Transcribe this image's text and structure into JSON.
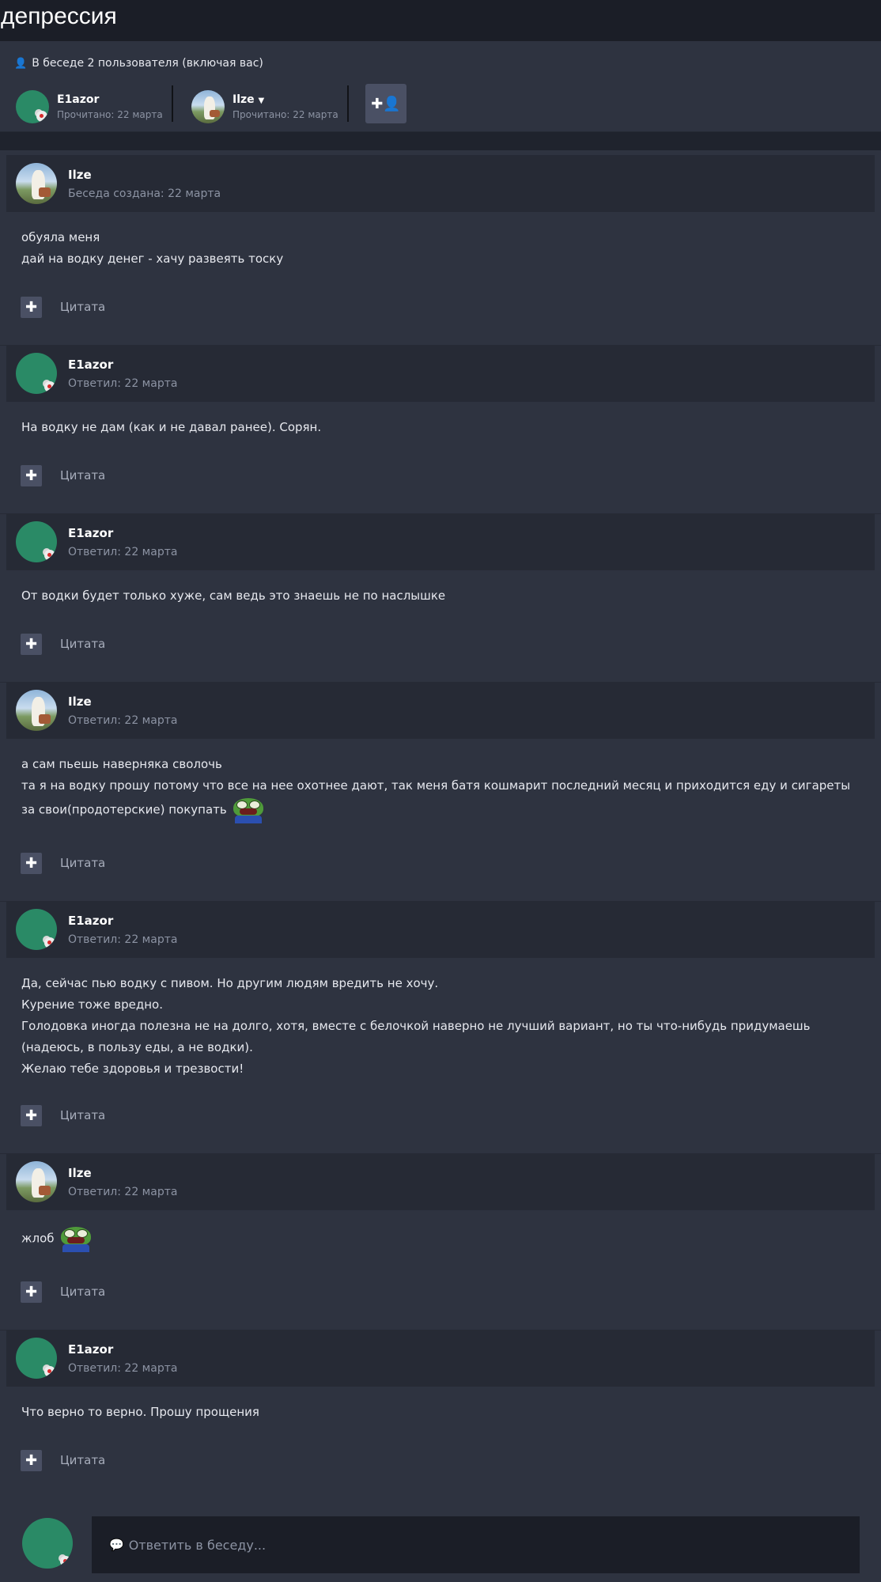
{
  "page": {
    "title": "депрессия"
  },
  "participants": {
    "heading": "В беседе 2 пользователя (включая вас)",
    "users": [
      {
        "name": "E1azor",
        "read": "Прочитано: 22 марта",
        "dropdown": false
      },
      {
        "name": "Ilze",
        "read": "Прочитано: 22 марта",
        "dropdown": true
      }
    ],
    "add_icon": "add-user-icon"
  },
  "posts": [
    {
      "author": "Ilze",
      "date": "Беседа создана: 22 марта",
      "lines": [
        "обуяла меня",
        "дай на водку денег - хачу развеять тоску"
      ],
      "quote_label": "Цитата"
    },
    {
      "author": "E1azor",
      "date": "Ответил: 22 марта",
      "lines": [
        "На водку не дам (как и не давал ранее). Сорян."
      ],
      "quote_label": "Цитата"
    },
    {
      "author": "E1azor",
      "date": "Ответил: 22 марта",
      "lines": [
        "От водки будет только хуже, сам ведь это знаешь не по наслышке"
      ],
      "quote_label": "Цитата"
    },
    {
      "author": "Ilze",
      "date": "Ответил: 22 марта",
      "lines": [
        "а сам пьешь наверняка сволочь",
        "та я на водку прошу потому что все на нее охотнее дают, так меня батя кошмарит последний месяц и приходится еду и сигареты за свои(продотерские) покупать"
      ],
      "quote_label": "Цитата"
    },
    {
      "author": "E1azor",
      "date": "Ответил: 22 марта",
      "lines": [
        "Да, сейчас пью водку с пивом. Но другим людям вредить не хочу.",
        "Курение тоже вредно.",
        "Голодовка иногда полезна не на долго, хотя, вместе с белочкой наверно не лучший вариант, но ты что-нибудь придумаешь (надеюсь, в пользу еды, а не водки).",
        "Желаю тебе здоровья и трезвости!"
      ],
      "quote_label": "Цитата"
    },
    {
      "author": "Ilze",
      "date": "Ответил: 22 марта",
      "lines": [
        "жлоб"
      ],
      "quote_label": "Цитата"
    },
    {
      "author": "E1azor",
      "date": "Ответил: 22 марта",
      "lines": [
        "Что верно то верно. Прошу прощения"
      ],
      "quote_label": "Цитата"
    }
  ],
  "reply": {
    "placeholder": "Ответить в беседу..."
  }
}
